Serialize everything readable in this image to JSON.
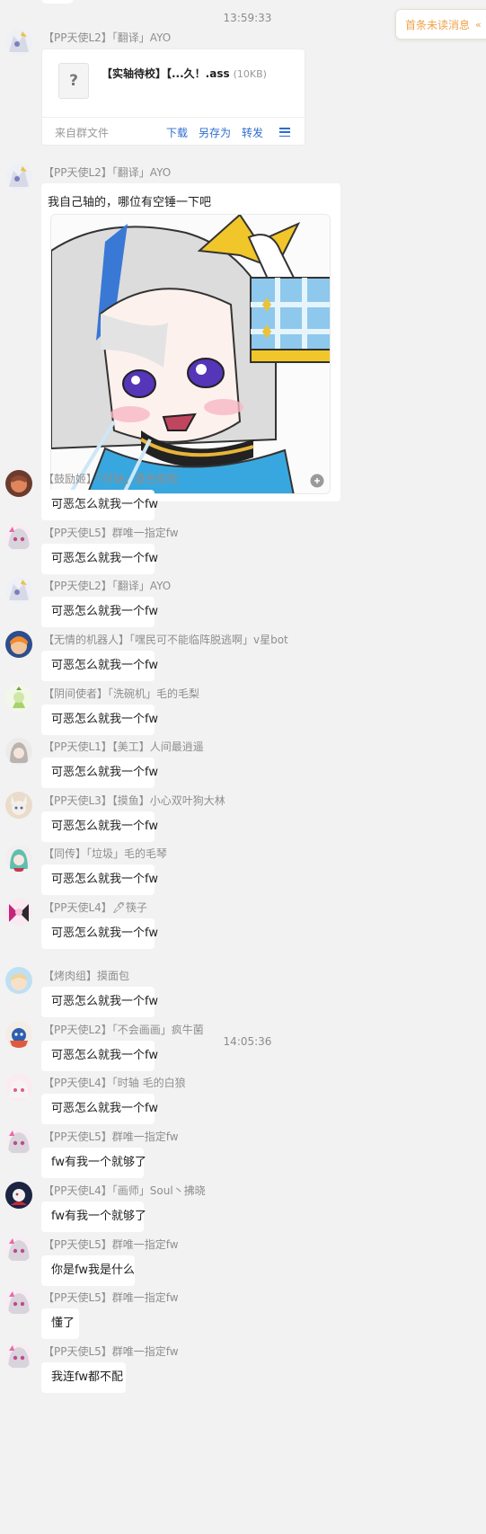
{
  "unread_banner": {
    "label": "首条未读消息",
    "chevron": "«"
  },
  "timestamps": [
    "13:59:33",
    "14:05:36"
  ],
  "file_message": {
    "sender": "【PP天使L2】「翻译」AYO",
    "file_icon": "?",
    "file_name": "【实轴待校】【...久！.ass",
    "file_size": "(10KB)",
    "source": "来自群文件",
    "actions": [
      "下载",
      "另存为",
      "转发"
    ]
  },
  "image_message": {
    "sender": "【PP天使L2】「翻译」AYO",
    "caption": "我自己轴的，哪位有空锤一下吧"
  },
  "messages": [
    {
      "sender": "【鼓励姬】「时轴」夏色祭爬",
      "text": "可恶怎么就我一个fw",
      "avatar": "orange"
    },
    {
      "sender": "【PP天使L5】群唯一指定fw",
      "text": "可恶怎么就我一个fw",
      "avatar": "pink"
    },
    {
      "sender": "【PP天使L2】「翻译」AYO",
      "text": "可恶怎么就我一个fw",
      "avatar": "silver"
    },
    {
      "sender": "【无情的机器人】「嘿民可不能临阵脱逃啊」v星bot",
      "text": "可恶怎么就我一个fw",
      "avatar": "blue"
    },
    {
      "sender": "【阴间使者】「洗碗机」毛的毛梨",
      "text": "可恶怎么就我一个fw",
      "avatar": "green"
    },
    {
      "sender": "【PP天使L1】【美工】人间最逍遥",
      "text": "可恶怎么就我一个fw",
      "avatar": "grey"
    },
    {
      "sender": "【PP天使L3】【摸鱼】小心双叶狗大林",
      "text": "可恶怎么就我一个fw",
      "avatar": "tan"
    },
    {
      "sender": "【同传】「垃圾」毛的毛琴",
      "text": "可恶怎么就我一个fw",
      "avatar": "teal"
    },
    {
      "sender": "【PP天使L4】🖋筷子",
      "text": "可恶怎么就我一个fw",
      "avatar": "magenta"
    },
    {
      "sender": "【烤肉组】摸面包",
      "text": "可恶怎么就我一个fw",
      "avatar": "sky"
    },
    {
      "sender": "【PP天使L2】「不会画画」疯牛菌",
      "text": "可恶怎么就我一个fw",
      "avatar": "red"
    },
    {
      "sender": "【PP天使L4】「时轴 毛的白狼",
      "text": "可恶怎么就我一个fw",
      "avatar": "rose"
    },
    {
      "sender": "【PP天使L5】群唯一指定fw",
      "text": "fw有我一个就够了",
      "avatar": "pink"
    },
    {
      "sender": "【PP天使L4】「画师」Soul丶拂晓",
      "text": "fw有我一个就够了",
      "avatar": "navy"
    },
    {
      "sender": "【PP天使L5】群唯一指定fw",
      "text": "你是fw我是什么",
      "avatar": "pink"
    },
    {
      "sender": "【PP天使L5】群唯一指定fw",
      "text": "懂了",
      "avatar": "pink"
    },
    {
      "sender": "【PP天使L5】群唯一指定fw",
      "text": "我连fw都不配",
      "avatar": "pink"
    }
  ],
  "colors": {
    "background": "#f2f2f2",
    "bubble": "#ffffff",
    "link": "#2f6ccf",
    "unread": "#f0a24a"
  }
}
